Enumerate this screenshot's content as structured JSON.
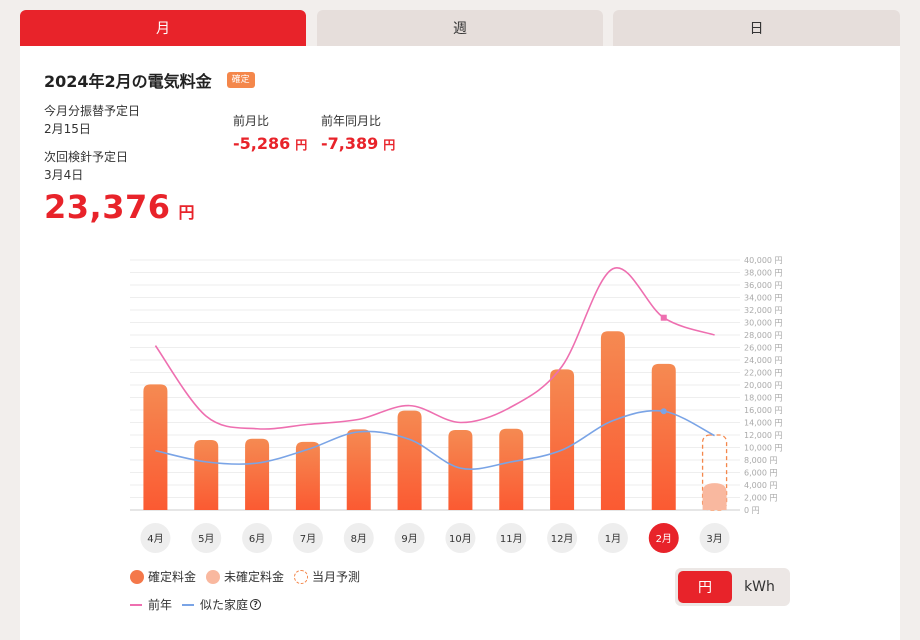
{
  "tabs": {
    "month": "月",
    "week": "週",
    "day": "日"
  },
  "header": {
    "title": "2024年2月の電気料金",
    "badge": "確定"
  },
  "info": {
    "transfer_label": "今月分振替予定日",
    "transfer_date": "2月15日",
    "next_meter_label": "次回検針予定日",
    "next_meter_date": "3月4日"
  },
  "total": {
    "amount": "23,376",
    "unit": "円"
  },
  "compare": {
    "prev_month_label": "前月比",
    "prev_month_value": "-5,286",
    "prev_year_label": "前年同月比",
    "prev_year_value": "-7,389",
    "unit": "円"
  },
  "legend": {
    "confirmed": "確定料金",
    "unconfirmed": "未確定料金",
    "forecast": "当月予測",
    "prev_year": "前年",
    "similar": "似た家庭"
  },
  "toggle": {
    "yen": "円",
    "kwh": "kWh"
  },
  "colors": {
    "accent": "#e8232a",
    "bar_top": "#f58a52",
    "bar_bottom": "#fb5a32",
    "unconfirmed": "#f9b89f",
    "forecast_border": "#f4874b",
    "prev_year_line": "#ee6fb0",
    "similar_line": "#7aa4e6"
  },
  "chart_data": {
    "type": "bar",
    "categories": [
      "4月",
      "5月",
      "6月",
      "7月",
      "8月",
      "9月",
      "10月",
      "11月",
      "12月",
      "1月",
      "2月",
      "3月"
    ],
    "selected": "2月",
    "series": [
      {
        "name": "確定料金",
        "type": "bar",
        "values": [
          20100,
          11200,
          11400,
          10900,
          12900,
          15900,
          12800,
          13000,
          22500,
          28600,
          23376,
          null
        ]
      },
      {
        "name": "未確定料金",
        "type": "bar",
        "values": [
          null,
          null,
          null,
          null,
          null,
          null,
          null,
          null,
          null,
          null,
          null,
          4300
        ]
      },
      {
        "name": "当月予測",
        "type": "bar-outline",
        "values": [
          null,
          null,
          null,
          null,
          null,
          null,
          null,
          null,
          null,
          null,
          null,
          12000
        ]
      },
      {
        "name": "前年",
        "type": "line",
        "values": [
          26300,
          15000,
          13000,
          13700,
          14500,
          16700,
          14000,
          16500,
          23000,
          38600,
          30765,
          28000
        ]
      },
      {
        "name": "似た家庭",
        "type": "line",
        "values": [
          9500,
          7700,
          7500,
          9700,
          12500,
          11300,
          6700,
          7700,
          9600,
          14300,
          15800,
          11900
        ]
      }
    ],
    "ylim": [
      0,
      40000
    ],
    "yticks": [
      "0 円",
      "2,000 円",
      "4,000 円",
      "6,000 円",
      "8,000 円",
      "10,000 円",
      "12,000 円",
      "14,000 円",
      "16,000 円",
      "18,000 円",
      "20,000 円",
      "22,000 円",
      "24,000 円",
      "26,000 円",
      "28,000 円",
      "30,000 円",
      "32,000 円",
      "34,000 円",
      "36,000 円",
      "38,000 円",
      "40,000 円"
    ],
    "grid": true,
    "y_axis_position": "right"
  }
}
